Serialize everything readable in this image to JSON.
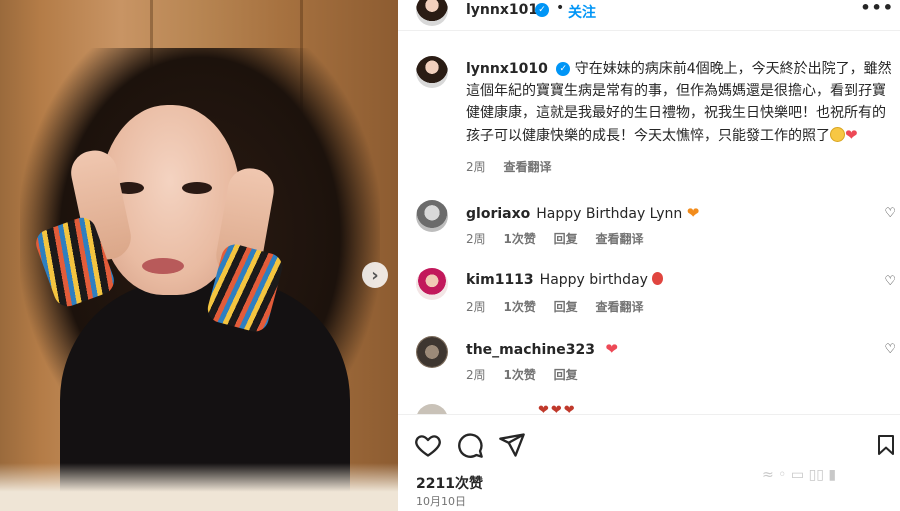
{
  "header": {
    "username": "lynnx1010",
    "separator": "•",
    "follow_label": "关注",
    "more_icon": "more-horizontal-icon"
  },
  "caption": {
    "username": "lynnx1010",
    "text": "守在妹妹的病床前4個晚上，今天終於出院了，雖然這個年紀的寶寶生病是常有的事，但作為媽媽還是很擔心，看到孖寶健健康康，這就是我最好的生日禮物，祝我生日快樂吧！也祝所有的孩子可以健康快樂的成長！今天太憔悴，只能發工作的照了",
    "time": "2周",
    "translate_label": "查看翻译"
  },
  "comments": [
    {
      "username": "gloriaxo",
      "text": "Happy Birthday Lynn",
      "emoji": "orange-heart",
      "time": "2周",
      "likes": "1次赞",
      "reply": "回复",
      "translate": "查看翻译"
    },
    {
      "username": "kim1113",
      "text": "Happy birthday",
      "emoji": "balloon",
      "time": "2周",
      "likes": "1次赞",
      "reply": "回复",
      "translate": "查看翻译"
    },
    {
      "username": "the_machine323",
      "text": "",
      "emoji": "red-heart",
      "time": "2周",
      "likes": "1次赞",
      "reply": "回复"
    }
  ],
  "actions": {
    "like_icon": "heart-outline-icon",
    "comment_icon": "comment-icon",
    "share_icon": "send-icon",
    "save_icon": "bookmark-icon"
  },
  "likes_count": "2211次赞",
  "post_date": "10月10日",
  "carousel_next_icon": "chevron-right-icon",
  "colors": {
    "accent": "#0095f6",
    "verified": "#0095f6",
    "heart": "#ed4956",
    "muted": "#737373"
  }
}
